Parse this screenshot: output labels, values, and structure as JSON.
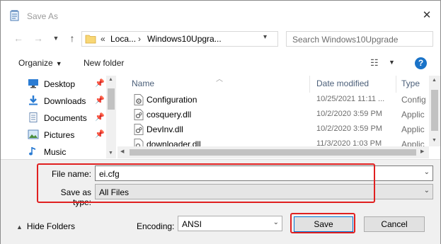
{
  "window": {
    "title": "Save As"
  },
  "nav": {
    "breadcrumb_prefix": "«",
    "breadcrumbs": [
      "Loca...",
      "Windows10Upgra..."
    ],
    "search_placeholder": "Search Windows10Upgrade"
  },
  "toolbar": {
    "organize_label": "Organize",
    "new_folder_label": "New folder",
    "help_label": "?"
  },
  "sidebar": {
    "items": [
      {
        "label": "Desktop",
        "icon": "desktop-icon"
      },
      {
        "label": "Downloads",
        "icon": "downloads-icon"
      },
      {
        "label": "Documents",
        "icon": "documents-icon"
      },
      {
        "label": "Pictures",
        "icon": "pictures-icon"
      },
      {
        "label": "Music",
        "icon": "music-icon"
      }
    ]
  },
  "files": {
    "columns": {
      "name": "Name",
      "date": "Date modified",
      "type": "Type"
    },
    "rows": [
      {
        "name": "Configuration",
        "date": "10/25/2021 11:11 ...",
        "type": "Config"
      },
      {
        "name": "cosquery.dll",
        "date": "10/2/2020 3:59 PM",
        "type": "Applic"
      },
      {
        "name": "DevInv.dll",
        "date": "10/2/2020 3:59 PM",
        "type": "Applic"
      },
      {
        "name": "downloader.dll",
        "date": "11/3/2020 1:03 PM",
        "type": "Applic"
      }
    ]
  },
  "form": {
    "filename_label": "File name:",
    "filename_value": "ei.cfg",
    "filetype_label": "Save as type:",
    "filetype_value": "All Files",
    "encoding_label": "Encoding:",
    "encoding_value": "ANSI",
    "hide_folders_label": "Hide Folders",
    "save_label": "Save",
    "cancel_label": "Cancel"
  },
  "colors": {
    "highlight_box": "#e02020",
    "help_blue": "#1a73c8"
  }
}
